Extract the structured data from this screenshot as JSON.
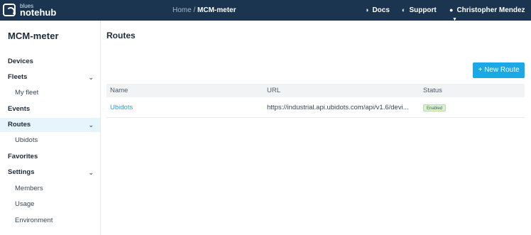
{
  "topbar": {
    "logo_top": "blues",
    "logo_bottom": "notehub",
    "breadcrumb_home": "Home",
    "breadcrumb_sep": " / ",
    "breadcrumb_current": "MCM-meter",
    "docs_label": "Docs",
    "support_label": "Support",
    "user_name": "Christopher Mendez",
    "docs_icon": "docs-icon",
    "support_icon": "support-icon",
    "user_icon": "user-circle-icon"
  },
  "sidebar": {
    "project_name": "MCM-meter",
    "items": [
      {
        "label": "Devices"
      },
      {
        "label": "Fleets"
      },
      {
        "label": "My fleet"
      },
      {
        "label": "Events"
      },
      {
        "label": "Routes"
      },
      {
        "label": "Ubidots"
      },
      {
        "label": "Favorites"
      },
      {
        "label": "Settings"
      },
      {
        "label": "Members"
      },
      {
        "label": "Usage"
      },
      {
        "label": "Environment"
      }
    ]
  },
  "main": {
    "title": "Routes",
    "new_route_label": "+ New Route",
    "table": {
      "headers": [
        "Name",
        "URL",
        "Status"
      ],
      "rows": [
        {
          "name": "Ubidots",
          "url": "https://industrial.api.ubidots.com/api/v1.6/devi...",
          "status": "Enabled"
        }
      ]
    }
  },
  "colors": {
    "topbar": "#1b3550",
    "accent": "#1aa8e6",
    "active_bg": "#e6f4fb",
    "enabled_badge": "#dcefd4"
  }
}
